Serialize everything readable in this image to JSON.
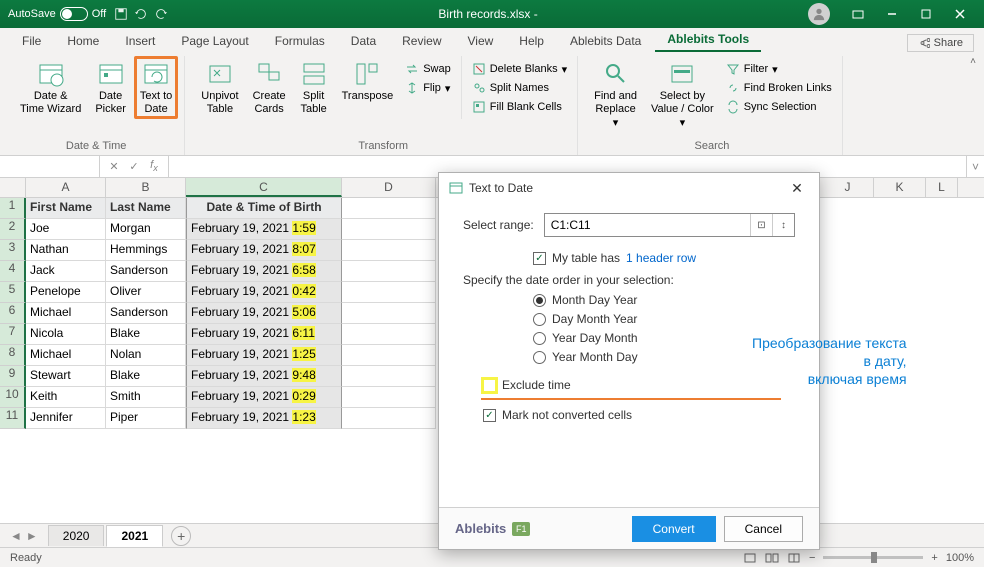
{
  "titlebar": {
    "autosave_label": "AutoSave",
    "autosave_state": "Off",
    "document_title": "Birth records.xlsx  -"
  },
  "tabs": {
    "items": [
      "File",
      "Home",
      "Insert",
      "Page Layout",
      "Formulas",
      "Data",
      "Review",
      "View",
      "Help",
      "Ablebits Data",
      "Ablebits Tools"
    ],
    "active": "Ablebits Tools",
    "share_label": "Share"
  },
  "ribbon": {
    "group1_label": "Date & Time",
    "group1": {
      "btn1": "Date &\nTime Wizard",
      "btn2": "Date\nPicker",
      "btn3": "Text to\nDate"
    },
    "group2_label": "Transform",
    "group2": {
      "btn1": "Unpivot\nTable",
      "btn2": "Create\nCards",
      "btn3": "Split\nTable",
      "btn4": "Transpose",
      "swap": "Swap",
      "flip": "Flip"
    },
    "group3": {
      "delete_blanks": "Delete Blanks",
      "split_names": "Split Names",
      "fill_blank": "Fill Blank Cells"
    },
    "group4_label": "Search",
    "group4": {
      "btn1": "Find and\nReplace",
      "btn2": "Select by\nValue / Color",
      "filter": "Filter",
      "find_broken": "Find Broken Links",
      "sync_sel": "Sync Selection"
    }
  },
  "namebox": {
    "value": ""
  },
  "columns": [
    "A",
    "B",
    "C",
    "D",
    "J",
    "K",
    "L"
  ],
  "col_widths": {
    "A": 80,
    "B": 80,
    "C": 156,
    "D": 94,
    "J": 52,
    "K": 52,
    "L": 32
  },
  "headers": {
    "a": "First Name",
    "b": "Last Name",
    "c": "Date & Time of Birth"
  },
  "rows": [
    {
      "n": "1"
    },
    {
      "n": "2",
      "a": "Joe",
      "b": "Morgan",
      "c_date": "February 19, 2021",
      "c_time": "1:59"
    },
    {
      "n": "3",
      "a": "Nathan",
      "b": "Hemmings",
      "c_date": "February 19, 2021",
      "c_time": "8:07"
    },
    {
      "n": "4",
      "a": "Jack",
      "b": "Sanderson",
      "c_date": "February 19, 2021",
      "c_time": "6:58"
    },
    {
      "n": "5",
      "a": "Penelope",
      "b": "Oliver",
      "c_date": "February 19, 2021",
      "c_time": "0:42"
    },
    {
      "n": "6",
      "a": "Michael",
      "b": "Sanderson",
      "c_date": "February 19, 2021",
      "c_time": "5:06"
    },
    {
      "n": "7",
      "a": "Nicola",
      "b": "Blake",
      "c_date": "February 19, 2021",
      "c_time": "6:11"
    },
    {
      "n": "8",
      "a": "Michael",
      "b": "Nolan",
      "c_date": "February 19, 2021",
      "c_time": "1:25"
    },
    {
      "n": "9",
      "a": "Stewart",
      "b": "Blake",
      "c_date": "February 19, 2021",
      "c_time": "9:48"
    },
    {
      "n": "10",
      "a": "Keith",
      "b": "Smith",
      "c_date": "February 19, 2021",
      "c_time": "0:29"
    },
    {
      "n": "11",
      "a": "Jennifer",
      "b": "Piper",
      "c_date": "February 19, 2021",
      "c_time": "1:23"
    }
  ],
  "sheets": {
    "tabs": [
      "2020",
      "2021"
    ],
    "active": "2021"
  },
  "statusbar": {
    "ready": "Ready",
    "zoom": "100%"
  },
  "dialog": {
    "title": "Text to Date",
    "select_range_label": "Select range:",
    "range_value": "C1:C11",
    "has_header_label": "My table has",
    "header_row_link": "1 header row",
    "date_order_label": "Specify the date order in your selection:",
    "radios": [
      "Month Day Year",
      "Day Month Year",
      "Year Day Month",
      "Year Month Day"
    ],
    "exclude_time": "Exclude time",
    "mark_not_converted": "Mark not converted cells",
    "brand": "Ablebits",
    "help_key": "F1",
    "convert": "Convert",
    "cancel": "Cancel"
  },
  "annotation": {
    "line1": "Преобразование текста",
    "line2": "в дату,",
    "line3": "включая время"
  }
}
